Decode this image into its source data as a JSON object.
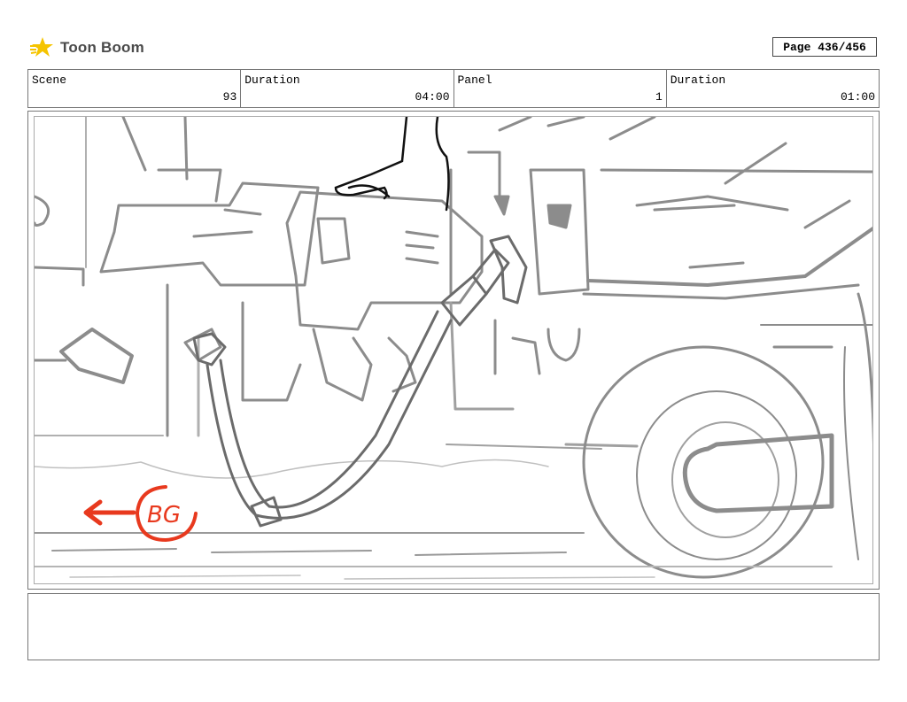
{
  "logo": {
    "text": "Toon Boom"
  },
  "page": {
    "label": "Page 436/456"
  },
  "header": {
    "scene_label": "Scene",
    "scene_value": "93",
    "duration_label": "Duration",
    "duration_value": "04:00",
    "panel_label": "Panel",
    "panel_value": "1",
    "panel_duration_label": "Duration",
    "panel_duration_value": "01:00"
  },
  "panel": {
    "annotation_text": "BG",
    "annotation_color": "#e8391e",
    "sketch_color": "#8c8c8c"
  },
  "notes": {
    "text": ""
  }
}
